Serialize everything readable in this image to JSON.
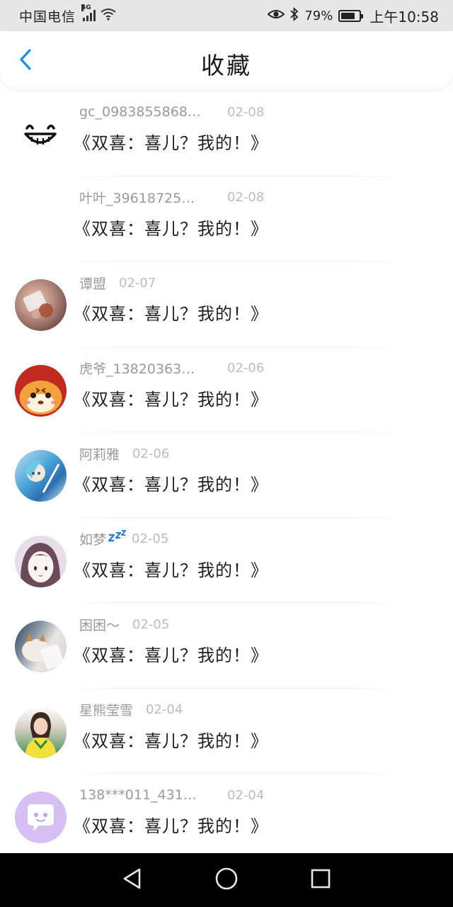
{
  "status_bar": {
    "carrier": "中国电信",
    "network_tag": "4G",
    "battery_percent": "79%",
    "battery_level": 0.79,
    "time": "上午10:58",
    "icons": [
      "signal-icon",
      "wifi-icon",
      "eye-comfort-icon",
      "bluetooth-icon",
      "battery-icon"
    ]
  },
  "header": {
    "title": "收藏",
    "back_icon": "chevron-left-icon",
    "accent_color": "#1a8cf0"
  },
  "items": [
    {
      "user": "gc_0983855868…",
      "date": "02-08",
      "title": "《双喜：喜儿？我的！》",
      "avatar": "grin-face"
    },
    {
      "user": "叶叶_39618725…",
      "date": "02-08",
      "title": "《双喜：喜儿？我的！》",
      "avatar": "blank"
    },
    {
      "user": "谭盟",
      "date": "02-07",
      "title": "《双喜：喜儿？我的！》",
      "avatar": "photo"
    },
    {
      "user": "虎爷_13820363…",
      "date": "02-06",
      "title": "《双喜：喜儿？我的！》",
      "avatar": "tiger"
    },
    {
      "user": "阿莉雅",
      "date": "02-06",
      "title": "《双喜：喜儿？我的！》",
      "avatar": "anime-blue"
    },
    {
      "user": "如梦",
      "date": "02-05",
      "title": "《双喜：喜儿？我的！》",
      "avatar": "anime-girl",
      "badge": "zzz-icon"
    },
    {
      "user": "困困～",
      "date": "02-05",
      "title": "《双喜：喜儿？我的！》",
      "avatar": "cat"
    },
    {
      "user": "星熊莹雪",
      "date": "02-04",
      "title": "《双喜：喜儿？我的！》",
      "avatar": "portrait"
    },
    {
      "user": "138***011_431…",
      "date": "02-04",
      "title": "《双喜：喜儿？我的！》",
      "avatar": "chat-bubble"
    }
  ],
  "system_nav": {
    "buttons": [
      "back-triangle-icon",
      "home-circle-icon",
      "recents-square-icon"
    ]
  }
}
